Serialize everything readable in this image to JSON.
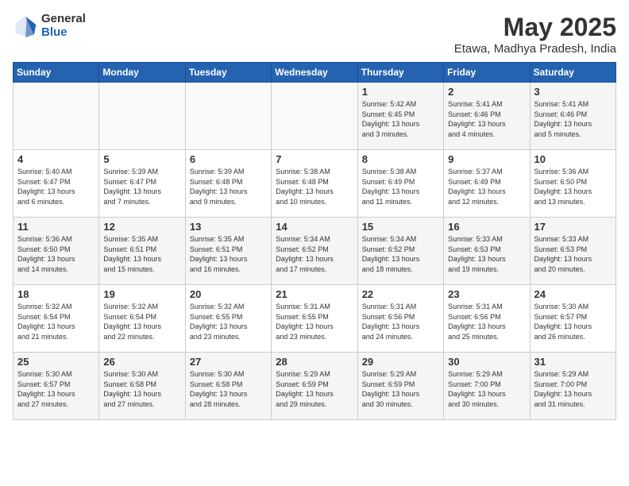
{
  "header": {
    "logo_general": "General",
    "logo_blue": "Blue",
    "month_year": "May 2025",
    "location": "Etawa, Madhya Pradesh, India"
  },
  "days_of_week": [
    "Sunday",
    "Monday",
    "Tuesday",
    "Wednesday",
    "Thursday",
    "Friday",
    "Saturday"
  ],
  "weeks": [
    [
      {
        "day": "",
        "info": ""
      },
      {
        "day": "",
        "info": ""
      },
      {
        "day": "",
        "info": ""
      },
      {
        "day": "",
        "info": ""
      },
      {
        "day": "1",
        "info": "Sunrise: 5:42 AM\nSunset: 6:45 PM\nDaylight: 13 hours\nand 3 minutes."
      },
      {
        "day": "2",
        "info": "Sunrise: 5:41 AM\nSunset: 6:46 PM\nDaylight: 13 hours\nand 4 minutes."
      },
      {
        "day": "3",
        "info": "Sunrise: 5:41 AM\nSunset: 6:46 PM\nDaylight: 13 hours\nand 5 minutes."
      }
    ],
    [
      {
        "day": "4",
        "info": "Sunrise: 5:40 AM\nSunset: 6:47 PM\nDaylight: 13 hours\nand 6 minutes."
      },
      {
        "day": "5",
        "info": "Sunrise: 5:39 AM\nSunset: 6:47 PM\nDaylight: 13 hours\nand 7 minutes."
      },
      {
        "day": "6",
        "info": "Sunrise: 5:39 AM\nSunset: 6:48 PM\nDaylight: 13 hours\nand 9 minutes."
      },
      {
        "day": "7",
        "info": "Sunrise: 5:38 AM\nSunset: 6:48 PM\nDaylight: 13 hours\nand 10 minutes."
      },
      {
        "day": "8",
        "info": "Sunrise: 5:38 AM\nSunset: 6:49 PM\nDaylight: 13 hours\nand 11 minutes."
      },
      {
        "day": "9",
        "info": "Sunrise: 5:37 AM\nSunset: 6:49 PM\nDaylight: 13 hours\nand 12 minutes."
      },
      {
        "day": "10",
        "info": "Sunrise: 5:36 AM\nSunset: 6:50 PM\nDaylight: 13 hours\nand 13 minutes."
      }
    ],
    [
      {
        "day": "11",
        "info": "Sunrise: 5:36 AM\nSunset: 6:50 PM\nDaylight: 13 hours\nand 14 minutes."
      },
      {
        "day": "12",
        "info": "Sunrise: 5:35 AM\nSunset: 6:51 PM\nDaylight: 13 hours\nand 15 minutes."
      },
      {
        "day": "13",
        "info": "Sunrise: 5:35 AM\nSunset: 6:51 PM\nDaylight: 13 hours\nand 16 minutes."
      },
      {
        "day": "14",
        "info": "Sunrise: 5:34 AM\nSunset: 6:52 PM\nDaylight: 13 hours\nand 17 minutes."
      },
      {
        "day": "15",
        "info": "Sunrise: 5:34 AM\nSunset: 6:52 PM\nDaylight: 13 hours\nand 18 minutes."
      },
      {
        "day": "16",
        "info": "Sunrise: 5:33 AM\nSunset: 6:53 PM\nDaylight: 13 hours\nand 19 minutes."
      },
      {
        "day": "17",
        "info": "Sunrise: 5:33 AM\nSunset: 6:53 PM\nDaylight: 13 hours\nand 20 minutes."
      }
    ],
    [
      {
        "day": "18",
        "info": "Sunrise: 5:32 AM\nSunset: 6:54 PM\nDaylight: 13 hours\nand 21 minutes."
      },
      {
        "day": "19",
        "info": "Sunrise: 5:32 AM\nSunset: 6:54 PM\nDaylight: 13 hours\nand 22 minutes."
      },
      {
        "day": "20",
        "info": "Sunrise: 5:32 AM\nSunset: 6:55 PM\nDaylight: 13 hours\nand 23 minutes."
      },
      {
        "day": "21",
        "info": "Sunrise: 5:31 AM\nSunset: 6:55 PM\nDaylight: 13 hours\nand 23 minutes."
      },
      {
        "day": "22",
        "info": "Sunrise: 5:31 AM\nSunset: 6:56 PM\nDaylight: 13 hours\nand 24 minutes."
      },
      {
        "day": "23",
        "info": "Sunrise: 5:31 AM\nSunset: 6:56 PM\nDaylight: 13 hours\nand 25 minutes."
      },
      {
        "day": "24",
        "info": "Sunrise: 5:30 AM\nSunset: 6:57 PM\nDaylight: 13 hours\nand 26 minutes."
      }
    ],
    [
      {
        "day": "25",
        "info": "Sunrise: 5:30 AM\nSunset: 6:57 PM\nDaylight: 13 hours\nand 27 minutes."
      },
      {
        "day": "26",
        "info": "Sunrise: 5:30 AM\nSunset: 6:58 PM\nDaylight: 13 hours\nand 27 minutes."
      },
      {
        "day": "27",
        "info": "Sunrise: 5:30 AM\nSunset: 6:58 PM\nDaylight: 13 hours\nand 28 minutes."
      },
      {
        "day": "28",
        "info": "Sunrise: 5:29 AM\nSunset: 6:59 PM\nDaylight: 13 hours\nand 29 minutes."
      },
      {
        "day": "29",
        "info": "Sunrise: 5:29 AM\nSunset: 6:59 PM\nDaylight: 13 hours\nand 30 minutes."
      },
      {
        "day": "30",
        "info": "Sunrise: 5:29 AM\nSunset: 7:00 PM\nDaylight: 13 hours\nand 30 minutes."
      },
      {
        "day": "31",
        "info": "Sunrise: 5:29 AM\nSunset: 7:00 PM\nDaylight: 13 hours\nand 31 minutes."
      }
    ]
  ]
}
